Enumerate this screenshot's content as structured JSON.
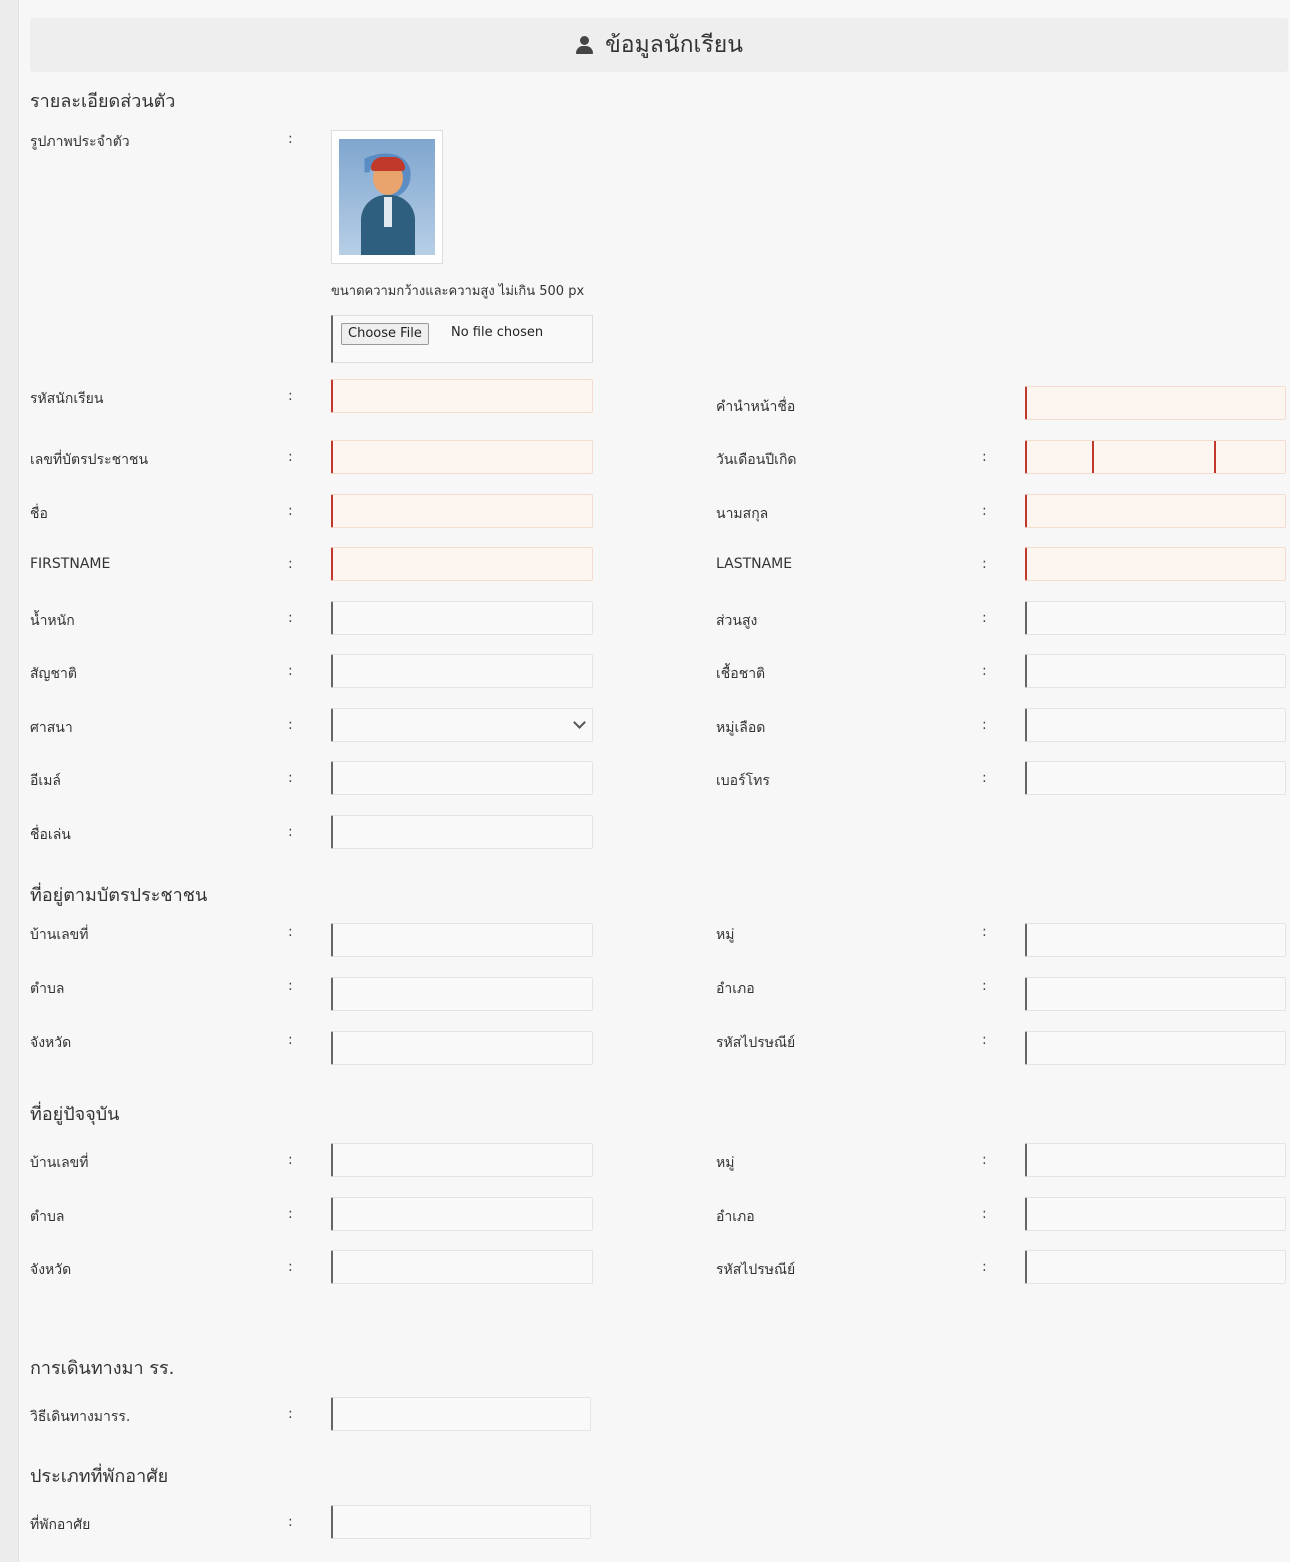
{
  "header": {
    "title": "ข้อมูลนักเรียน",
    "icon": "user-icon"
  },
  "sections": {
    "personal": "รายละเอียดส่วนตัว",
    "id_address": "ที่อยู่ตามบัตรประชาชน",
    "current_address": "ที่อยู่ปัจจุบัน",
    "travel": "การเดินทางมา รร.",
    "residence": "ประเภทที่พักอาศัย"
  },
  "photo": {
    "label": "รูปภาพประจำตัว",
    "hint": "ขนาดความกว้างและความสูง ไม่เกิน 500 px",
    "choose_file": "Choose File",
    "no_file": "No file chosen"
  },
  "colon": ":",
  "personal": {
    "left": [
      {
        "label": "รหัสนักเรียน"
      },
      {
        "label": "เลขที่บัตรประชาชน"
      },
      {
        "label": "ชื่อ"
      },
      {
        "label": "FIRSTNAME"
      },
      {
        "label": "น้ำหนัก"
      },
      {
        "label": "สัญชาติ"
      },
      {
        "label": "ศาสนา"
      },
      {
        "label": "อีเมล์"
      },
      {
        "label": "ชื่อเล่น"
      }
    ],
    "right": [
      {
        "label": "คำนำหน้าชื่อ"
      },
      {
        "label": "วันเดือนปีเกิด"
      },
      {
        "label": "นามสกุล"
      },
      {
        "label": "LASTNAME"
      },
      {
        "label": "ส่วนสูง"
      },
      {
        "label": "เชื้อชาติ"
      },
      {
        "label": "หมู่เลือด"
      },
      {
        "label": "เบอร์โทร"
      }
    ]
  },
  "id_address": {
    "left": [
      {
        "label": "บ้านเลขที่"
      },
      {
        "label": "ตำบล"
      },
      {
        "label": "จังหวัด"
      }
    ],
    "right": [
      {
        "label": "หมู่"
      },
      {
        "label": "อำเภอ"
      },
      {
        "label": "รหัสไปรษณีย์"
      }
    ]
  },
  "current_address": {
    "left": [
      {
        "label": "บ้านเลขที่"
      },
      {
        "label": "ตำบล"
      },
      {
        "label": "จังหวัด"
      }
    ],
    "right": [
      {
        "label": "หมู่"
      },
      {
        "label": "อำเภอ"
      },
      {
        "label": "รหัสไปรษณีย์"
      }
    ]
  },
  "travel": {
    "label": "วิธีเดินทางมารร."
  },
  "residence": {
    "label": "ที่พักอาศัย"
  }
}
